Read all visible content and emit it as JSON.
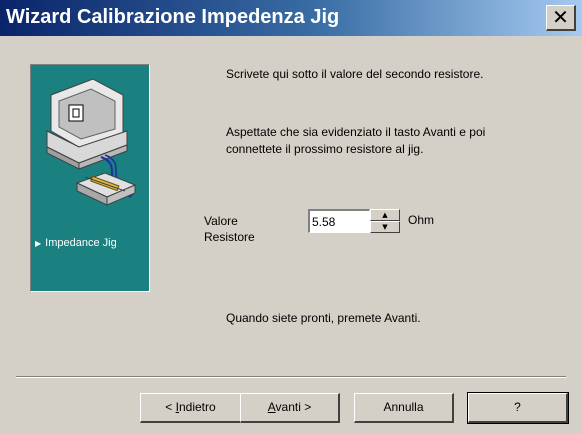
{
  "window": {
    "title": "Wizard Calibrazione Impedenza Jig",
    "close_glyph": "✕"
  },
  "side_panel": {
    "label": "Impedance Jig",
    "arrow_glyph": "▶",
    "background_color": "#1a8080"
  },
  "content": {
    "paragraph1": "Scrivete qui sotto il valore del secondo resistore.",
    "paragraph2": "Aspettate che sia evidenziato il tasto Avanti e poi connettete il prossimo resistore al jig.",
    "field_label": "Valore Resistore",
    "field_value": "5.58",
    "unit": "Ohm",
    "footer_text": "Quando siete pronti, premete Avanti."
  },
  "buttons": {
    "back_prefix": "< ",
    "back_mnemonic": "I",
    "back_rest": "ndietro",
    "next_mnemonic": "A",
    "next_rest": "vanti >",
    "cancel": "Annulla",
    "help": "?"
  },
  "colors": {
    "titlebar_start": "#0a246a",
    "titlebar_end": "#a6caf0",
    "face": "#d4d0c8"
  }
}
